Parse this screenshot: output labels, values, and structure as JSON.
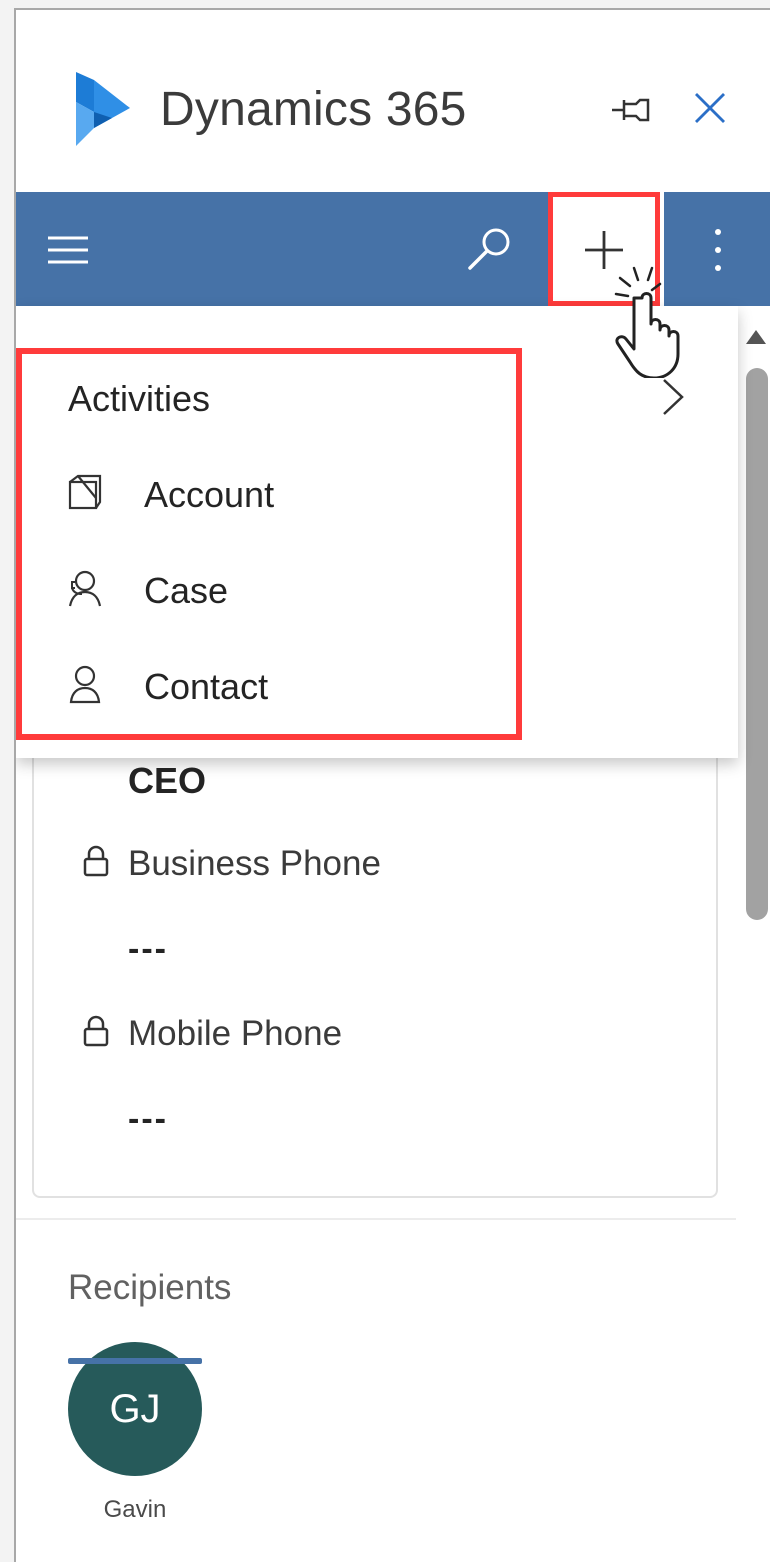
{
  "window": {
    "app_title": "Dynamics 365",
    "accent_color": "#4672a7",
    "highlight_color": "#ff3b3b"
  },
  "titlebar": {
    "logo_icon": "dynamics-logo",
    "pin_icon": "pin-icon",
    "close_icon": "close-icon"
  },
  "commandbar": {
    "menu_icon": "hamburger-icon",
    "search_icon": "search-icon",
    "new_icon": "plus-icon",
    "more_icon": "more-vertical-icon"
  },
  "new_menu": {
    "items": [
      {
        "label": "Activities",
        "icon": "chevron-right-icon",
        "has_submenu": true
      },
      {
        "label": "Account",
        "icon": "account-icon"
      },
      {
        "label": "Case",
        "icon": "case-icon"
      },
      {
        "label": "Contact",
        "icon": "contact-icon"
      }
    ]
  },
  "contact_card": {
    "job_title": "CEO",
    "fields": [
      {
        "label": "Business Phone",
        "value": "---",
        "icon": "lock-icon"
      },
      {
        "label": "Mobile Phone",
        "value": "---",
        "icon": "lock-icon"
      }
    ]
  },
  "recipients": {
    "label": "Recipients",
    "people": [
      {
        "initials": "GJ",
        "name": "Gavin",
        "avatar_color": "#265a5a"
      }
    ]
  }
}
